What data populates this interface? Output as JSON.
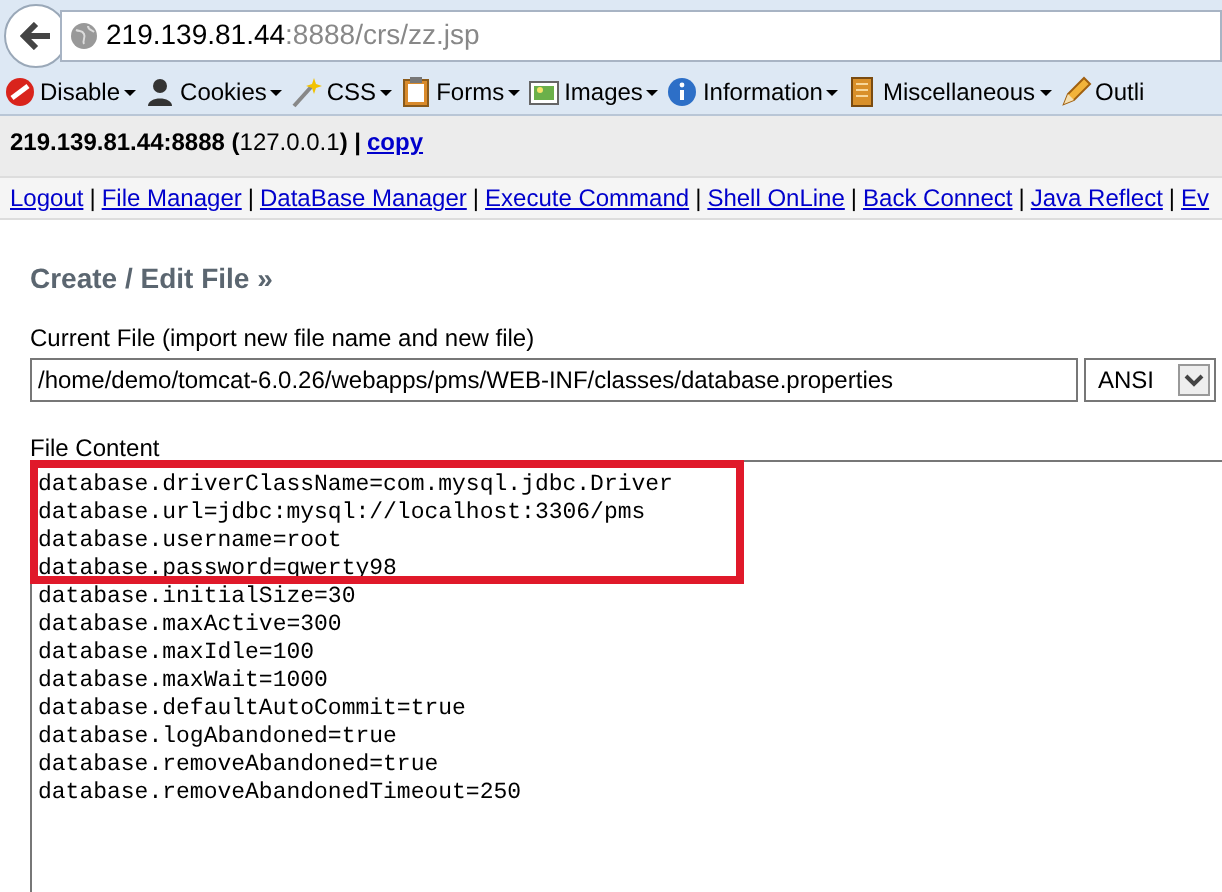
{
  "address_bar": {
    "host": "219.139.81.44",
    "rest": ":8888/crs/zz.jsp"
  },
  "toolbar": [
    {
      "label": "Disable"
    },
    {
      "label": "Cookies"
    },
    {
      "label": "CSS"
    },
    {
      "label": "Forms"
    },
    {
      "label": "Images"
    },
    {
      "label": "Information"
    },
    {
      "label": "Miscellaneous"
    },
    {
      "label": "Outli"
    }
  ],
  "host_line": {
    "host": "219.139.81.44:8888 (",
    "ip": "127.0.0.1",
    ") |": ") |",
    "link": "copy"
  },
  "nav_links": [
    {
      "label": "Logout",
      "separator": "|"
    },
    {
      "label": "File Manager",
      "separator": "|"
    },
    {
      "label": "DataBase Manager",
      "separator": "|"
    },
    {
      "label": "Execute Command",
      "separator": "|"
    },
    {
      "label": "Shell OnLine",
      "separator": "|"
    },
    {
      "label": "Back Connect",
      "separator": "|"
    },
    {
      "label": "Java Reflect",
      "separator": "|"
    },
    {
      "label": "Ev"
    }
  ],
  "heading": "Create / Edit File »",
  "current_file": {
    "label": "Current File (import new file name and new file)",
    "value": "/home/demo/tomcat-6.0.26/webapps/pms/WEB-INF/classes/database.properties",
    "encoding": "ANSI"
  },
  "file_content": {
    "label": "File Content",
    "lines": [
      "database.driverClassName=com.mysql.jdbc.Driver",
      "database.url=jdbc:mysql://localhost:3306/pms",
      "database.username=root",
      "database.password=qwerty98",
      "database.initialSize=30",
      "database.maxActive=300",
      "database.maxIdle=100",
      "database.maxWait=1000",
      "database.defaultAutoCommit=true",
      "database.logAbandoned=true",
      "database.removeAbandoned=true",
      "database.removeAbandonedTimeout=250"
    ]
  }
}
